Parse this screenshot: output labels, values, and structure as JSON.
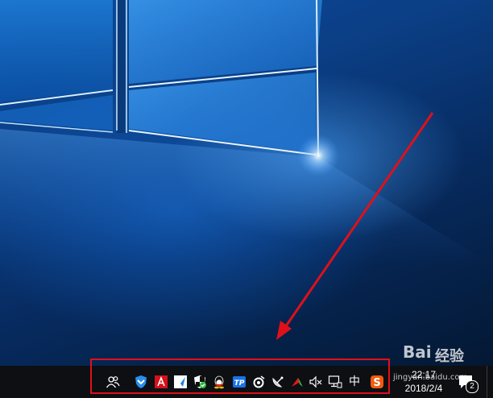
{
  "colors": {
    "taskbar": "#0d0f12",
    "annotation_red": "#e0101a",
    "desktop_blue": "#0b3f86"
  },
  "taskbar": {
    "tray_icons": [
      {
        "name": "people-icon"
      },
      {
        "name": "baidu-guard-icon"
      },
      {
        "name": "adobe-icon"
      },
      {
        "name": "feishu-icon"
      },
      {
        "name": "security-shield-icon"
      },
      {
        "name": "qq-icon"
      },
      {
        "name": "thunder-icon"
      },
      {
        "name": "steelseries-icon"
      },
      {
        "name": "satellite-icon"
      },
      {
        "name": "arrow-up-icon"
      },
      {
        "name": "volume-muted-icon"
      },
      {
        "name": "network-icon"
      }
    ],
    "ime_mode": "中",
    "sogou_icon": "sogou-icon",
    "clock": {
      "time": "22:17",
      "date": "2018/2/4"
    },
    "notification_count": "2"
  },
  "watermark": {
    "logo": "Bai",
    "text": "经验",
    "url": "jingyan.baidu.com"
  }
}
